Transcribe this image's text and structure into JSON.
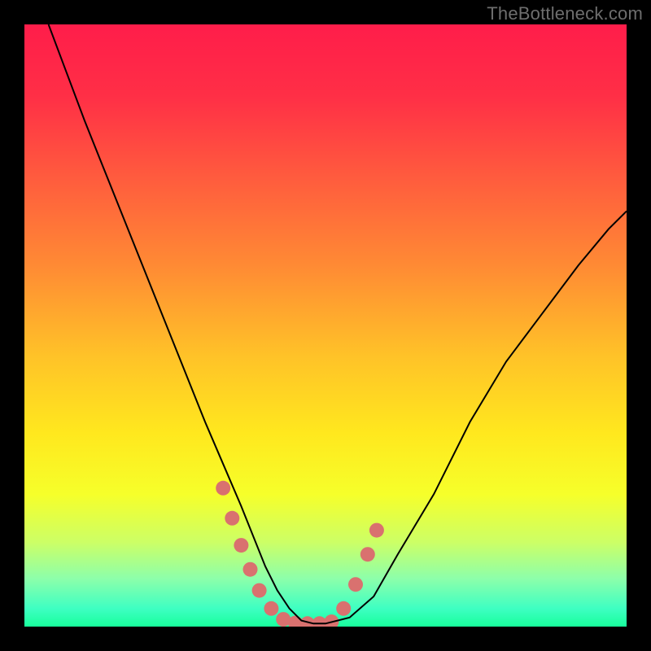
{
  "watermark": "TheBottleneck.com",
  "chart_data": {
    "type": "line",
    "title": "",
    "xlabel": "",
    "ylabel": "",
    "xlim": [
      0,
      100
    ],
    "ylim": [
      0,
      100
    ],
    "background_gradient": {
      "type": "vertical",
      "stops": [
        {
          "pos": 0.0,
          "color": "#ff1d4a"
        },
        {
          "pos": 0.12,
          "color": "#ff2f46"
        },
        {
          "pos": 0.25,
          "color": "#ff5a3e"
        },
        {
          "pos": 0.4,
          "color": "#ff8a34"
        },
        {
          "pos": 0.55,
          "color": "#ffc228"
        },
        {
          "pos": 0.68,
          "color": "#ffe81e"
        },
        {
          "pos": 0.78,
          "color": "#f6ff2a"
        },
        {
          "pos": 0.86,
          "color": "#ccff66"
        },
        {
          "pos": 0.92,
          "color": "#8dffaa"
        },
        {
          "pos": 0.97,
          "color": "#3effc2"
        },
        {
          "pos": 1.0,
          "color": "#18ff9c"
        }
      ]
    },
    "series": [
      {
        "name": "bottleneck-curve",
        "color": "#000000",
        "stroke_width": 2,
        "x": [
          4,
          7,
          10,
          14,
          18,
          22,
          26,
          30,
          33,
          36,
          38,
          40,
          42,
          44,
          46,
          48,
          50,
          54,
          58,
          62,
          68,
          74,
          80,
          86,
          92,
          97,
          100
        ],
        "y": [
          100,
          92,
          84,
          74,
          64,
          54,
          44,
          34,
          27,
          20,
          15,
          10,
          6,
          3,
          1,
          0.5,
          0.5,
          1.5,
          5,
          12,
          22,
          34,
          44,
          52,
          60,
          66,
          69
        ]
      }
    ],
    "markers": {
      "name": "highlight-markers",
      "color": "#d9716f",
      "radius": 9,
      "points": [
        {
          "x": 33.0,
          "y": 23.0
        },
        {
          "x": 34.5,
          "y": 18.0
        },
        {
          "x": 36.0,
          "y": 13.5
        },
        {
          "x": 37.5,
          "y": 9.5
        },
        {
          "x": 39.0,
          "y": 6.0
        },
        {
          "x": 41.0,
          "y": 3.0
        },
        {
          "x": 43.0,
          "y": 1.2
        },
        {
          "x": 45.0,
          "y": 0.6
        },
        {
          "x": 47.0,
          "y": 0.5
        },
        {
          "x": 49.0,
          "y": 0.5
        },
        {
          "x": 51.0,
          "y": 0.8
        },
        {
          "x": 53.0,
          "y": 3.0
        },
        {
          "x": 55.0,
          "y": 7.0
        },
        {
          "x": 57.0,
          "y": 12.0
        },
        {
          "x": 58.5,
          "y": 16.0
        }
      ]
    }
  }
}
